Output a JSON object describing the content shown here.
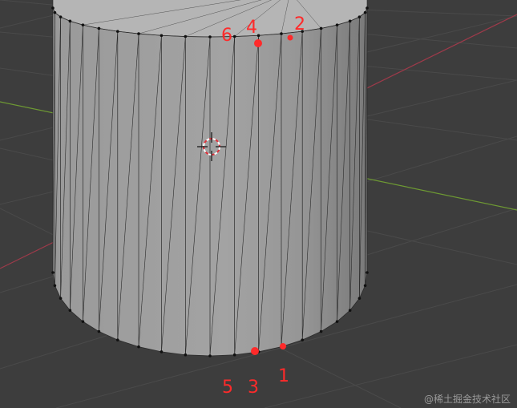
{
  "viewport": {
    "background_color": "#3d3d3d",
    "grid_color": "#4a4a4a",
    "x_axis_color": "#9e3a4a",
    "y_axis_color": "#6e9a33"
  },
  "object": {
    "type": "cylinder mesh",
    "body_color": "#a3a3a3",
    "edge_color": "#2b2b2b",
    "vertex_color": "#111111"
  },
  "selection_color": "#ff2a2a",
  "vertex_labels": {
    "v1": "1",
    "v2": "2",
    "v3": "3",
    "v4": "4",
    "v5": "5",
    "v6": "6"
  },
  "cursor_3d": {
    "icon": "3d-cursor-icon"
  },
  "watermark": "@稀土掘金技术社区"
}
